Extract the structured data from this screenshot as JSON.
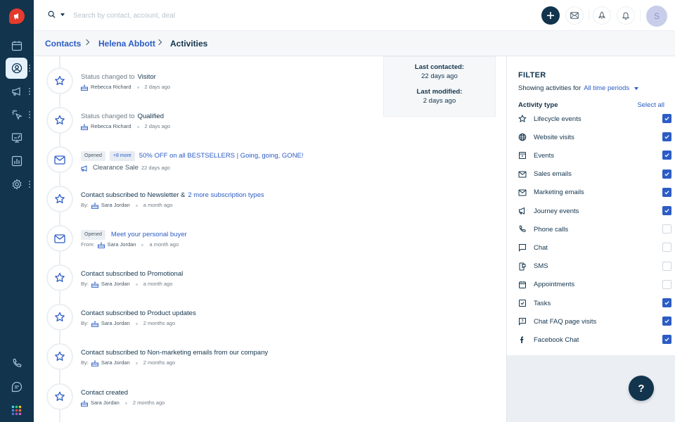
{
  "app": {
    "logo_icon": "megaphone-icon",
    "accent_color": "#2c5cc5",
    "sidebar_color": "#12344d",
    "logo_color": "#e43b2c"
  },
  "sidebar": {
    "items": [
      {
        "icon": "calendar-icon",
        "active": false
      },
      {
        "icon": "contact-icon",
        "active": true
      },
      {
        "icon": "megaphone-icon",
        "active": false
      },
      {
        "icon": "cursor-click-icon",
        "active": false
      },
      {
        "icon": "monitor-edit-icon",
        "active": false
      },
      {
        "icon": "bar-chart-icon",
        "active": false
      },
      {
        "icon": "gear-icon",
        "active": false
      }
    ],
    "bottom_items": [
      {
        "icon": "phone-icon"
      },
      {
        "icon": "chat-icon"
      },
      {
        "icon": "apps-grid-icon"
      }
    ]
  },
  "topbar": {
    "search_placeholder": "Search by contact, account, deal",
    "avatar_initial": "S",
    "buttons": [
      "plus-icon",
      "mail-icon",
      "rocket-icon",
      "bell-icon"
    ]
  },
  "breadcrumb": {
    "items": [
      "Contacts",
      "Helena Abbott"
    ],
    "current": "Activities"
  },
  "info_card": {
    "last_contacted_label": "Last contacted:",
    "last_contacted_value": "22 days ago",
    "last_modified_label": "Last modified:",
    "last_modified_value": "2 days ago"
  },
  "timeline": [
    {
      "type": "lifecycle",
      "muted": "Status changed to",
      "title": "Visitor",
      "by": "",
      "name": "Rebecca Richard",
      "time": "2 days ago"
    },
    {
      "type": "lifecycle",
      "muted": "Status changed to",
      "title": "Qualified",
      "by": "",
      "name": "Rebecca Richard",
      "time": "2 days ago"
    },
    {
      "type": "email",
      "badge": "Opened",
      "badge2": "+8 more",
      "link": "50% OFF on all BESTSELLERS | Going, going, GONE!",
      "campaign": "Clearance Sale",
      "time": "22 days ago"
    },
    {
      "type": "lifecycle",
      "title": "Contact subscribed to Newsletter &",
      "link": "2 more subscription types",
      "by": "By:",
      "name": "Sara Jordan",
      "time": "a month ago"
    },
    {
      "type": "email",
      "badge": "Opened",
      "link": "Meet your personal buyer",
      "by": "From:",
      "name": "Sara Jordan",
      "time": "a month ago"
    },
    {
      "type": "lifecycle",
      "title": "Contact subscribed to Promotional",
      "by": "By:",
      "name": "Sara Jordan",
      "time": "a month ago"
    },
    {
      "type": "lifecycle",
      "title": "Contact subscribed to Product updates",
      "by": "By:",
      "name": "Sara Jordan",
      "time": "2 months ago"
    },
    {
      "type": "lifecycle",
      "title": "Contact subscribed to Non-marketing emails from our company",
      "by": "By:",
      "name": "Sara Jordan",
      "time": "2 months ago"
    },
    {
      "type": "lifecycle",
      "title": "Contact created",
      "by": "",
      "name": "Sara Jordan",
      "time": "2 months ago"
    }
  ],
  "filter": {
    "title": "FILTER",
    "showing_label": "Showing activities for",
    "period": "All time periods",
    "activity_type_label": "Activity type",
    "select_all": "Select all",
    "items": [
      {
        "label": "Lifecycle events",
        "icon": "star-icon",
        "checked": true
      },
      {
        "label": "Website visits",
        "icon": "globe-icon",
        "checked": true
      },
      {
        "label": "Events",
        "icon": "event-calendar-icon",
        "checked": true
      },
      {
        "label": "Sales emails",
        "icon": "mail-icon",
        "checked": true
      },
      {
        "label": "Marketing emails",
        "icon": "mail-icon",
        "checked": true
      },
      {
        "label": "Journey events",
        "icon": "megaphone-icon",
        "checked": true
      },
      {
        "label": "Phone calls",
        "icon": "phone-icon",
        "checked": false
      },
      {
        "label": "Chat",
        "icon": "chat-bubble-icon",
        "checked": false
      },
      {
        "label": "SMS",
        "icon": "sms-icon",
        "checked": false
      },
      {
        "label": "Appointments",
        "icon": "calendar-icon",
        "checked": false
      },
      {
        "label": "Tasks",
        "icon": "task-check-icon",
        "checked": true
      },
      {
        "label": "Chat FAQ page visits",
        "icon": "faq-chat-icon",
        "checked": true
      },
      {
        "label": "Facebook Chat",
        "icon": "facebook-icon",
        "checked": true
      }
    ]
  },
  "help": {
    "label": "?"
  }
}
